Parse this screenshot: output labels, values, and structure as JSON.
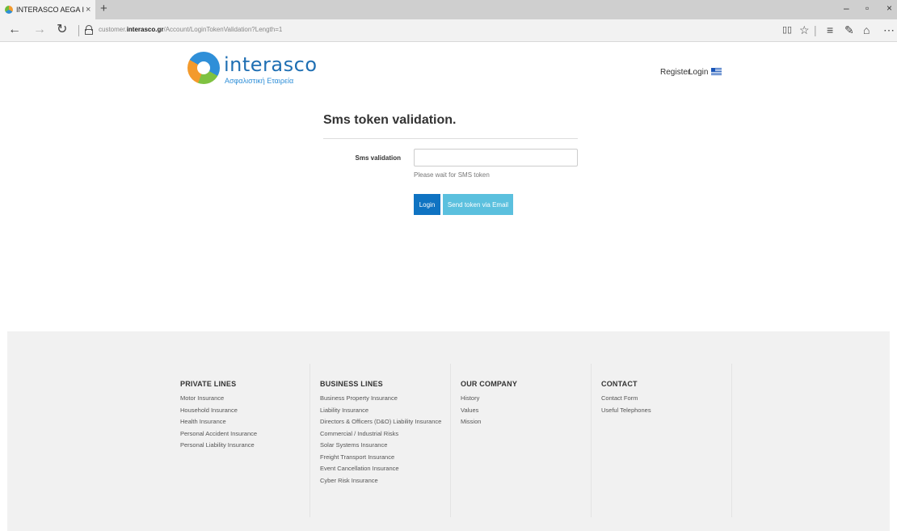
{
  "browser": {
    "tab_title": "INTERASCO AEGA Insur",
    "tab_close": "×",
    "new_tab": "+",
    "window_min": "–",
    "window_restore": "▫",
    "window_close": "×",
    "url_prefix": "customer.",
    "url_domain": "interasco.gr",
    "url_path": "/Account/LoginTokenValidation?Length=1",
    "icons": [
      "back-icon",
      "forward-icon",
      "refresh-icon",
      "lock-icon",
      "reading-view-icon",
      "favorite-star-icon",
      "hub-icon",
      "web-note-icon",
      "share-icon",
      "more-icon"
    ]
  },
  "header": {
    "logo_name": "interasco",
    "logo_subtitle": "Ασφαλιστική Εταιρεία",
    "nav_register": "Register",
    "nav_login": "Login",
    "language_flag": "greek-flag-icon"
  },
  "form": {
    "title": "Sms token validation.",
    "sms_label": "Sms validation",
    "sms_value": "",
    "sms_placeholder": "",
    "help_text": "Please wait for SMS token",
    "login_button": "Login",
    "email_button": "Send token via Email",
    "colors": {
      "login_button": "#0f73c2",
      "email_button": "#5bc0de"
    }
  },
  "footer": {
    "columns": [
      {
        "heading": "PRIVATE LINES",
        "items": [
          "Motor Insurance",
          "Household Insurance",
          "Health Insurance",
          "Personal Accident Insurance",
          "Personal Liability Insurance"
        ]
      },
      {
        "heading": "BUSINESS LINES",
        "items": [
          "Business Property Insurance",
          "Liability Insurance",
          "Directors & Officers (D&O) Liability Insurance",
          "Commercial / Industrial Risks",
          "Solar Systems Insurance",
          "Freight Transport Insurance",
          "Event Cancellation Insurance",
          "Cyber Risk Insurance"
        ]
      },
      {
        "heading": "OUR COMPANY",
        "items": [
          "History",
          "Values",
          "Mission"
        ]
      },
      {
        "heading": "CONTACT",
        "items": [
          "Contact Form",
          "Useful Telephones"
        ]
      }
    ]
  }
}
